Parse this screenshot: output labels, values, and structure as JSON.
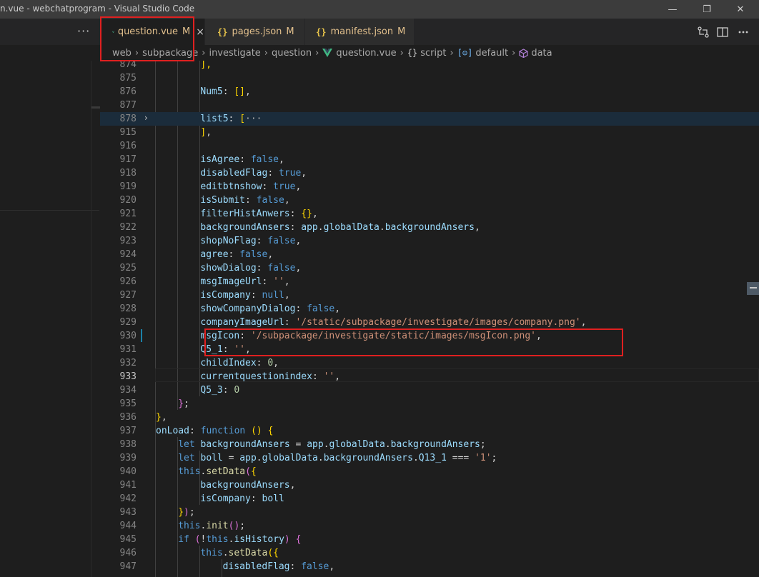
{
  "window": {
    "title": "n.vue - webchatprogram - Visual Studio Code",
    "minimize": "—",
    "restore": "❐",
    "close": "✕"
  },
  "toolbar": {
    "more_label": "···"
  },
  "tabs": [
    {
      "label": "question.vue",
      "badge": "M",
      "icon": "vue-icon",
      "active": true,
      "close": "×"
    },
    {
      "label": "pages.json",
      "badge": "M",
      "icon": "json-icon",
      "active": false,
      "glyph": "{}"
    },
    {
      "label": "manifest.json",
      "badge": "M",
      "icon": "json-icon",
      "active": false,
      "glyph": "{}"
    }
  ],
  "breadcrumb": {
    "items": [
      "web",
      "subpackage",
      "investigate",
      "question",
      "question.vue",
      "script",
      "default",
      "data"
    ],
    "glyphs": {
      "script": "{}",
      "default": "[⊝]"
    }
  },
  "editor": {
    "current_line": "933",
    "lines": [
      {
        "num": "874",
        "tokens": [
          [
            "t-br",
            "],"
          ]
        ]
      },
      {
        "num": "875",
        "tokens": []
      },
      {
        "num": "876",
        "tokens": [
          [
            "t-key",
            "Num5"
          ],
          [
            "t-pun",
            ": "
          ],
          [
            "t-br",
            "[]"
          ],
          [
            "t-pun",
            ","
          ]
        ]
      },
      {
        "num": "877",
        "tokens": []
      },
      {
        "num": "878",
        "tokens": [
          [
            "t-key",
            "list5"
          ],
          [
            "t-pun",
            ": "
          ],
          [
            "t-br",
            "["
          ],
          [
            "t-fold",
            "···"
          ]
        ],
        "highlight": true,
        "fold": true
      },
      {
        "num": "915",
        "tokens": [
          [
            "t-br",
            "]"
          ],
          [
            "t-pun",
            ","
          ]
        ]
      },
      {
        "num": "916",
        "tokens": []
      },
      {
        "num": "917",
        "tokens": [
          [
            "t-key",
            "isAgree"
          ],
          [
            "t-pun",
            ": "
          ],
          [
            "t-kw",
            "false"
          ],
          [
            "t-pun",
            ","
          ]
        ]
      },
      {
        "num": "918",
        "tokens": [
          [
            "t-key",
            "disabledFlag"
          ],
          [
            "t-pun",
            ": "
          ],
          [
            "t-kw",
            "true"
          ],
          [
            "t-pun",
            ","
          ]
        ]
      },
      {
        "num": "919",
        "tokens": [
          [
            "t-key",
            "editbtnshow"
          ],
          [
            "t-pun",
            ": "
          ],
          [
            "t-kw",
            "true"
          ],
          [
            "t-pun",
            ","
          ]
        ]
      },
      {
        "num": "920",
        "tokens": [
          [
            "t-key",
            "isSubmit"
          ],
          [
            "t-pun",
            ": "
          ],
          [
            "t-kw",
            "false"
          ],
          [
            "t-pun",
            ","
          ]
        ]
      },
      {
        "num": "921",
        "tokens": [
          [
            "t-key",
            "filterHistAnwers"
          ],
          [
            "t-pun",
            ": "
          ],
          [
            "t-br",
            "{}"
          ],
          [
            "t-pun",
            ","
          ]
        ]
      },
      {
        "num": "922",
        "tokens": [
          [
            "t-key",
            "backgroundAnsers"
          ],
          [
            "t-pun",
            ": "
          ],
          [
            "t-key",
            "app"
          ],
          [
            "t-pun",
            "."
          ],
          [
            "t-key",
            "globalData"
          ],
          [
            "t-pun",
            "."
          ],
          [
            "t-key",
            "backgroundAnsers"
          ],
          [
            "t-pun",
            ","
          ]
        ]
      },
      {
        "num": "923",
        "tokens": [
          [
            "t-key",
            "shopNoFlag"
          ],
          [
            "t-pun",
            ": "
          ],
          [
            "t-kw",
            "false"
          ],
          [
            "t-pun",
            ","
          ]
        ]
      },
      {
        "num": "924",
        "tokens": [
          [
            "t-key",
            "agree"
          ],
          [
            "t-pun",
            ": "
          ],
          [
            "t-kw",
            "false"
          ],
          [
            "t-pun",
            ","
          ]
        ]
      },
      {
        "num": "925",
        "tokens": [
          [
            "t-key",
            "showDialog"
          ],
          [
            "t-pun",
            ": "
          ],
          [
            "t-kw",
            "false"
          ],
          [
            "t-pun",
            ","
          ]
        ]
      },
      {
        "num": "926",
        "tokens": [
          [
            "t-key",
            "msgImageUrl"
          ],
          [
            "t-pun",
            ": "
          ],
          [
            "t-str",
            "''"
          ],
          [
            "t-pun",
            ","
          ]
        ]
      },
      {
        "num": "927",
        "tokens": [
          [
            "t-key",
            "isCompany"
          ],
          [
            "t-pun",
            ": "
          ],
          [
            "t-kw",
            "null"
          ],
          [
            "t-pun",
            ","
          ]
        ]
      },
      {
        "num": "928",
        "tokens": [
          [
            "t-key",
            "showCompanyDialog"
          ],
          [
            "t-pun",
            ": "
          ],
          [
            "t-kw",
            "false"
          ],
          [
            "t-pun",
            ","
          ]
        ]
      },
      {
        "num": "929",
        "tokens": [
          [
            "t-key",
            "companyImageUrl"
          ],
          [
            "t-pun",
            ": "
          ],
          [
            "t-str",
            "'/static/subpackage/investigate/images/company.png'"
          ],
          [
            "t-pun",
            ","
          ]
        ]
      },
      {
        "num": "930",
        "tokens": [
          [
            "t-key",
            "msgIcon"
          ],
          [
            "t-pun",
            ": "
          ],
          [
            "t-str",
            "'/subpackage/investigate/static/images/msgIcon.png'"
          ],
          [
            "t-pun",
            ","
          ]
        ]
      },
      {
        "num": "931",
        "tokens": [
          [
            "t-key",
            "Q5_1"
          ],
          [
            "t-pun",
            ": "
          ],
          [
            "t-str",
            "''"
          ],
          [
            "t-pun",
            ","
          ]
        ]
      },
      {
        "num": "932",
        "tokens": [
          [
            "t-key",
            "childIndex"
          ],
          [
            "t-pun",
            ": "
          ],
          [
            "t-num",
            "0"
          ],
          [
            "t-pun",
            ","
          ]
        ]
      },
      {
        "num": "933",
        "tokens": [
          [
            "t-key",
            "currentquestionindex"
          ],
          [
            "t-pun",
            ": "
          ],
          [
            "t-str",
            "''"
          ],
          [
            "t-pun",
            ","
          ]
        ]
      },
      {
        "num": "934",
        "tokens": [
          [
            "t-key",
            "Q5_3"
          ],
          [
            "t-pun",
            ": "
          ],
          [
            "t-num",
            "0"
          ]
        ]
      },
      {
        "num": "935",
        "tokens": [
          [
            "t-br2",
            "}"
          ],
          [
            "t-pun",
            ";"
          ]
        ]
      },
      {
        "num": "936",
        "tokens": [
          [
            "t-br",
            "}"
          ],
          [
            "t-pun",
            ","
          ]
        ]
      },
      {
        "num": "937",
        "tokens": [
          [
            "t-key",
            "onLoad"
          ],
          [
            "t-pun",
            ": "
          ],
          [
            "t-kw",
            "function"
          ],
          [
            "t-pun",
            " "
          ],
          [
            "t-br",
            "()"
          ],
          [
            "t-pun",
            " "
          ],
          [
            "t-br",
            "{"
          ]
        ]
      },
      {
        "num": "938",
        "tokens": [
          [
            "t-kw",
            "let"
          ],
          [
            "t-pun",
            " "
          ],
          [
            "t-key",
            "backgroundAnsers"
          ],
          [
            "t-pun",
            " = "
          ],
          [
            "t-key",
            "app"
          ],
          [
            "t-pun",
            "."
          ],
          [
            "t-key",
            "globalData"
          ],
          [
            "t-pun",
            "."
          ],
          [
            "t-key",
            "backgroundAnsers"
          ],
          [
            "t-pun",
            ";"
          ]
        ]
      },
      {
        "num": "939",
        "tokens": [
          [
            "t-kw",
            "let"
          ],
          [
            "t-pun",
            " "
          ],
          [
            "t-key",
            "boll"
          ],
          [
            "t-pun",
            " = "
          ],
          [
            "t-key",
            "app"
          ],
          [
            "t-pun",
            "."
          ],
          [
            "t-key",
            "globalData"
          ],
          [
            "t-pun",
            "."
          ],
          [
            "t-key",
            "backgroundAnsers"
          ],
          [
            "t-pun",
            "."
          ],
          [
            "t-key",
            "Q13_1"
          ],
          [
            "t-pun",
            " === "
          ],
          [
            "t-str",
            "'1'"
          ],
          [
            "t-pun",
            ";"
          ]
        ]
      },
      {
        "num": "940",
        "tokens": [
          [
            "t-kw",
            "this"
          ],
          [
            "t-pun",
            "."
          ],
          [
            "t-fn",
            "setData"
          ],
          [
            "t-br2",
            "("
          ],
          [
            "t-br",
            "{"
          ]
        ]
      },
      {
        "num": "941",
        "tokens": [
          [
            "t-key",
            "backgroundAnsers"
          ],
          [
            "t-pun",
            ","
          ]
        ]
      },
      {
        "num": "942",
        "tokens": [
          [
            "t-key",
            "isCompany"
          ],
          [
            "t-pun",
            ": "
          ],
          [
            "t-key",
            "boll"
          ]
        ]
      },
      {
        "num": "943",
        "tokens": [
          [
            "t-br",
            "}"
          ],
          [
            "t-br2",
            ")"
          ],
          [
            "t-pun",
            ";"
          ]
        ]
      },
      {
        "num": "944",
        "tokens": [
          [
            "t-kw",
            "this"
          ],
          [
            "t-pun",
            "."
          ],
          [
            "t-fn",
            "init"
          ],
          [
            "t-br2",
            "()"
          ],
          [
            "t-pun",
            ";"
          ]
        ]
      },
      {
        "num": "945",
        "tokens": [
          [
            "t-kw",
            "if"
          ],
          [
            "t-pun",
            " "
          ],
          [
            "t-br2",
            "("
          ],
          [
            "t-pun",
            "!"
          ],
          [
            "t-kw",
            "this"
          ],
          [
            "t-pun",
            "."
          ],
          [
            "t-key",
            "isHistory"
          ],
          [
            "t-br2",
            ")"
          ],
          [
            "t-pun",
            " "
          ],
          [
            "t-br2",
            "{"
          ]
        ]
      },
      {
        "num": "946",
        "tokens": [
          [
            "t-kw",
            "this"
          ],
          [
            "t-pun",
            "."
          ],
          [
            "t-fn",
            "setData"
          ],
          [
            "t-br",
            "("
          ],
          [
            "t-br",
            "{"
          ]
        ]
      },
      {
        "num": "947",
        "tokens": [
          [
            "t-key",
            "disabledFlag"
          ],
          [
            "t-pun",
            ": "
          ],
          [
            "t-kw",
            "false"
          ],
          [
            "t-pun",
            ","
          ]
        ]
      }
    ]
  }
}
